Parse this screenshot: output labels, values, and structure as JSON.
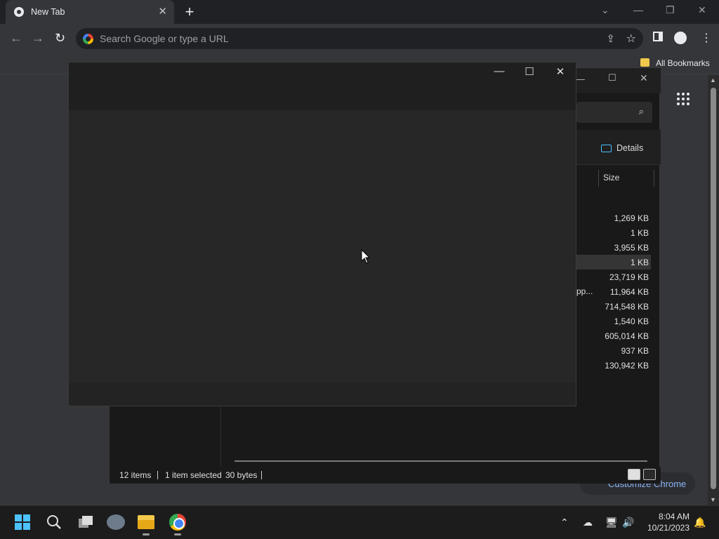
{
  "browser": {
    "tab_title": "New Tab",
    "omnibox_placeholder": "Search Google or type a URL",
    "bookmarks_label": "All Bookmarks",
    "customize_label": "Customize Chrome"
  },
  "explorer": {
    "details_label": "Details",
    "size_header": "Size",
    "rows": [
      "1,269 KB",
      "1 KB",
      "3,955 KB",
      "1 KB",
      "23,719 KB",
      "11,964 KB",
      "714,548 KB",
      "1,540 KB",
      "605,014 KB",
      "937 KB",
      "130,942 KB"
    ],
    "selected_row_index": 3,
    "truncated_name": "pp...",
    "status_items": "12 items",
    "status_selected": "1 item selected",
    "status_bytes": "30 bytes"
  },
  "taskbar": {
    "time": "8:04 AM",
    "date": "10/21/2023"
  },
  "colors": {
    "chrome_dark": "#202124",
    "chrome_toolbar": "#35363a",
    "accent": "#4cc2ff",
    "link": "#8ab4f8"
  }
}
